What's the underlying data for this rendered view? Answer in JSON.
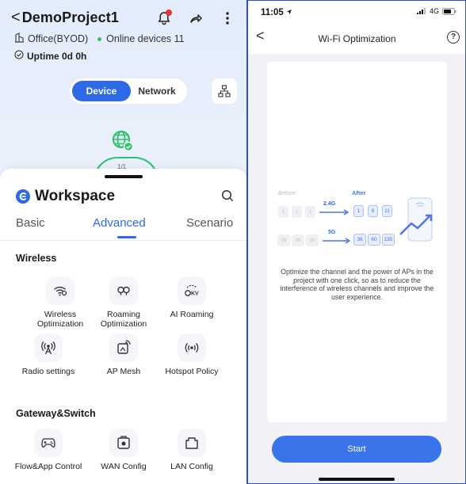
{
  "left_phone": {
    "header": {
      "back_glyph": "<",
      "project_name": "DemoProject1",
      "icons": [
        "notification-bell-icon",
        "share-icon",
        "more-vertical-icon"
      ]
    },
    "info": {
      "office_label": "Office(BYOD)",
      "online_devices": "Online devices 11",
      "uptime": "Uptime 0d 0h"
    },
    "segment": {
      "active": "Device",
      "inactive": "Network"
    },
    "topology": {
      "pager": "1/1"
    },
    "workspace": {
      "title": "Workspace",
      "tabs": [
        "Basic",
        "Advanced",
        "Scenario"
      ],
      "active_tab": "Advanced",
      "sections": [
        {
          "heading": "Wireless",
          "items": [
            {
              "label": "Wireless Optimization",
              "icon": "wifi-optimize-icon"
            },
            {
              "label": "Roaming Optimization",
              "icon": "roaming-icon"
            },
            {
              "label": "AI Roaming",
              "icon": "ai-roaming-icon"
            },
            {
              "label": "Radio settings",
              "icon": "radio-tower-icon"
            },
            {
              "label": "AP Mesh",
              "icon": "ap-mesh-icon"
            },
            {
              "label": "Hotspot Policy",
              "icon": "hotspot-icon"
            }
          ]
        },
        {
          "heading": "Gateway&Switch",
          "items": [
            {
              "label": "Flow&App Control",
              "icon": "gamepad-icon"
            },
            {
              "label": "WAN Config",
              "icon": "wan-config-icon"
            },
            {
              "label": "LAN Config",
              "icon": "lan-config-icon"
            }
          ]
        }
      ]
    }
  },
  "right_phone": {
    "status": {
      "time": "11:05",
      "network": "4G"
    },
    "nav": {
      "back_glyph": "<",
      "title": "Wi-Fi Optimization",
      "help": "?"
    },
    "illustration": {
      "before_label": "Before",
      "after_label": "After",
      "band_24": "2.4G",
      "band_5": "5G",
      "before_24_channels": [
        "1",
        "1",
        "1"
      ],
      "after_24_channels": [
        "1",
        "6",
        "11"
      ],
      "before_5_channels": [
        "36",
        "36",
        "36"
      ],
      "after_5_channels": [
        "36",
        "60",
        "135"
      ]
    },
    "description": "Optimize the channel and the power of APs in the project with one click, so as to reduce the interference of wireless channels and improve the user experience.",
    "start_button": "Start"
  },
  "colors": {
    "accent_blue": "#2d6ae3",
    "online_green": "#2cc36b",
    "notification_red": "#e8352e",
    "frame_blue": "#2b4fd6"
  }
}
